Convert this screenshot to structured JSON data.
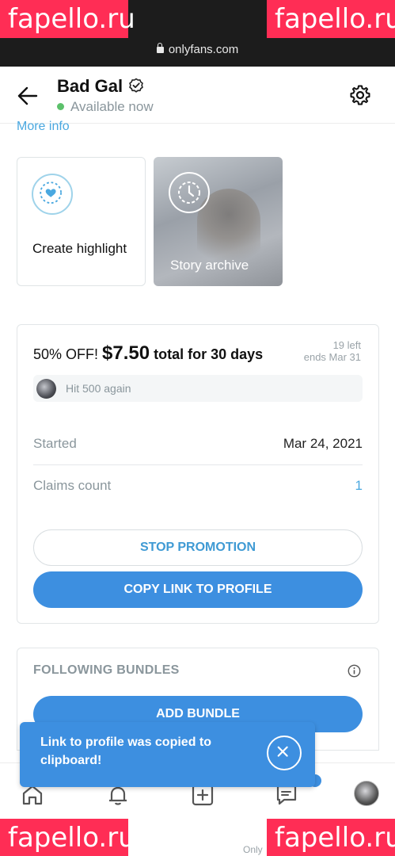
{
  "browser": {
    "url": "onlyfans.com"
  },
  "watermarks": [
    "fapello.ru",
    "fapello.ru",
    "fapello.ru",
    "fapello.ru"
  ],
  "header": {
    "name": "Bad Gal",
    "status": "Available now"
  },
  "profile": {
    "more_info": "More info"
  },
  "highlights": [
    {
      "label": "Create highlight"
    },
    {
      "label": "Story archive"
    }
  ],
  "promotion": {
    "title_prefix": "50% OFF!",
    "price": "$7.50",
    "title_suffix": "total for 30 days",
    "left": "19 left",
    "ends": "ends Mar 31",
    "message": "Hit 500 again",
    "started_label": "Started",
    "started_value": "Mar 24, 2021",
    "claims_label": "Claims count",
    "claims_value": "1",
    "stop_label": "STOP PROMOTION",
    "copy_label": "COPY LINK TO PROFILE"
  },
  "bundles": {
    "title": "FOLLOWING BUNDLES",
    "add_label": "ADD BUNDLE"
  },
  "toast": {
    "message": "Link to profile was copied to clipboard!"
  },
  "bottom": {
    "partial_text": "Only"
  },
  "colors": {
    "accent": "#3d8fe0",
    "link": "#4aa8e0",
    "online": "#5cc16b",
    "watermark": "#ff2d55"
  }
}
